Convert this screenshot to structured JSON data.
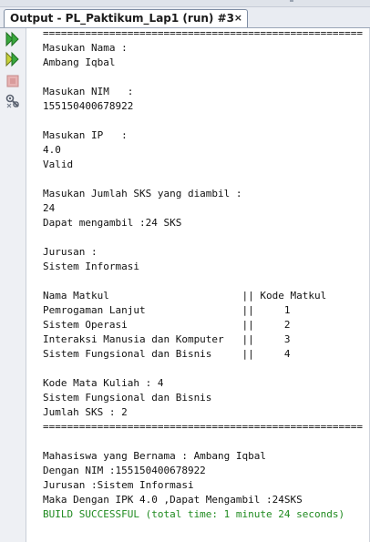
{
  "tab": {
    "title": "Output - PL_Paktikum_Lap1 (run) #3",
    "close_glyph": "×"
  },
  "toolbar": {
    "icons": [
      "rerun-icon",
      "rerun-with-options-icon",
      "stop-icon",
      "settings-icon"
    ]
  },
  "colors": {
    "success_text": "#1f8a1f",
    "rerun_green": "#2e9e32"
  },
  "console": {
    "lines": [
      "=====================================================",
      "Masukan Nama :",
      "Ambang Iqbal",
      "",
      "Masukan NIM   :",
      "155150400678922",
      "",
      "Masukan IP   :",
      "4.0",
      "Valid",
      "",
      "Masukan Jumlah SKS yang diambil :",
      "24",
      "Dapat mengambil :24 SKS",
      "",
      "Jurusan :",
      "Sistem Informasi",
      "",
      "Nama Matkul                      || Kode Matkul",
      "Pemrogaman Lanjut                ||     1",
      "Sistem Operasi                   ||     2",
      "Interaksi Manusia dan Komputer   ||     3",
      "Sistem Fungsional dan Bisnis     ||     4",
      "",
      "Kode Mata Kuliah : 4",
      "Sistem Fungsional dan Bisnis",
      "Jumlah SKS : 2",
      "=====================================================",
      "",
      "Mahasiswa yang Bernama : Ambang Iqbal",
      "Dengan NIM :155150400678922",
      "Jurusan :Sistem Informasi",
      "Maka Dengan IPK 4.0 ,Dapat Mengambil :24SKS",
      "BUILD SUCCESSFUL (total time: 1 minute 24 seconds)"
    ]
  }
}
